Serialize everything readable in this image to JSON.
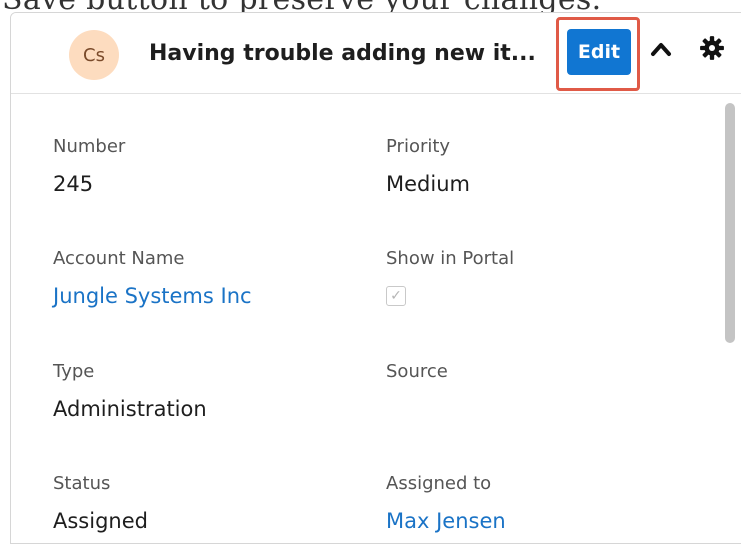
{
  "background_caption": "Save button to preserve your changes.",
  "header": {
    "avatar_initials": "Cs",
    "title": "Having trouble adding new it...",
    "edit_label": "Edit"
  },
  "fields": {
    "number": {
      "label": "Number",
      "value": "245"
    },
    "priority": {
      "label": "Priority",
      "value": "Medium"
    },
    "account_name": {
      "label": "Account Name",
      "value": "Jungle Systems Inc"
    },
    "show_in_portal": {
      "label": "Show in Portal",
      "checked": true
    },
    "type": {
      "label": "Type",
      "value": "Administration"
    },
    "source": {
      "label": "Source",
      "value": ""
    },
    "status": {
      "label": "Status",
      "value": "Assigned"
    },
    "assigned_to": {
      "label": "Assigned to",
      "value": "Max Jensen"
    }
  },
  "colors": {
    "accent": "#1176d2",
    "link": "#1a73c6",
    "highlight_border": "#e05a47",
    "avatar_bg": "#fddcbf"
  },
  "icons": {
    "collapse": "chevron-up-icon",
    "settings": "gear-icon",
    "checkbox": "check-icon"
  }
}
